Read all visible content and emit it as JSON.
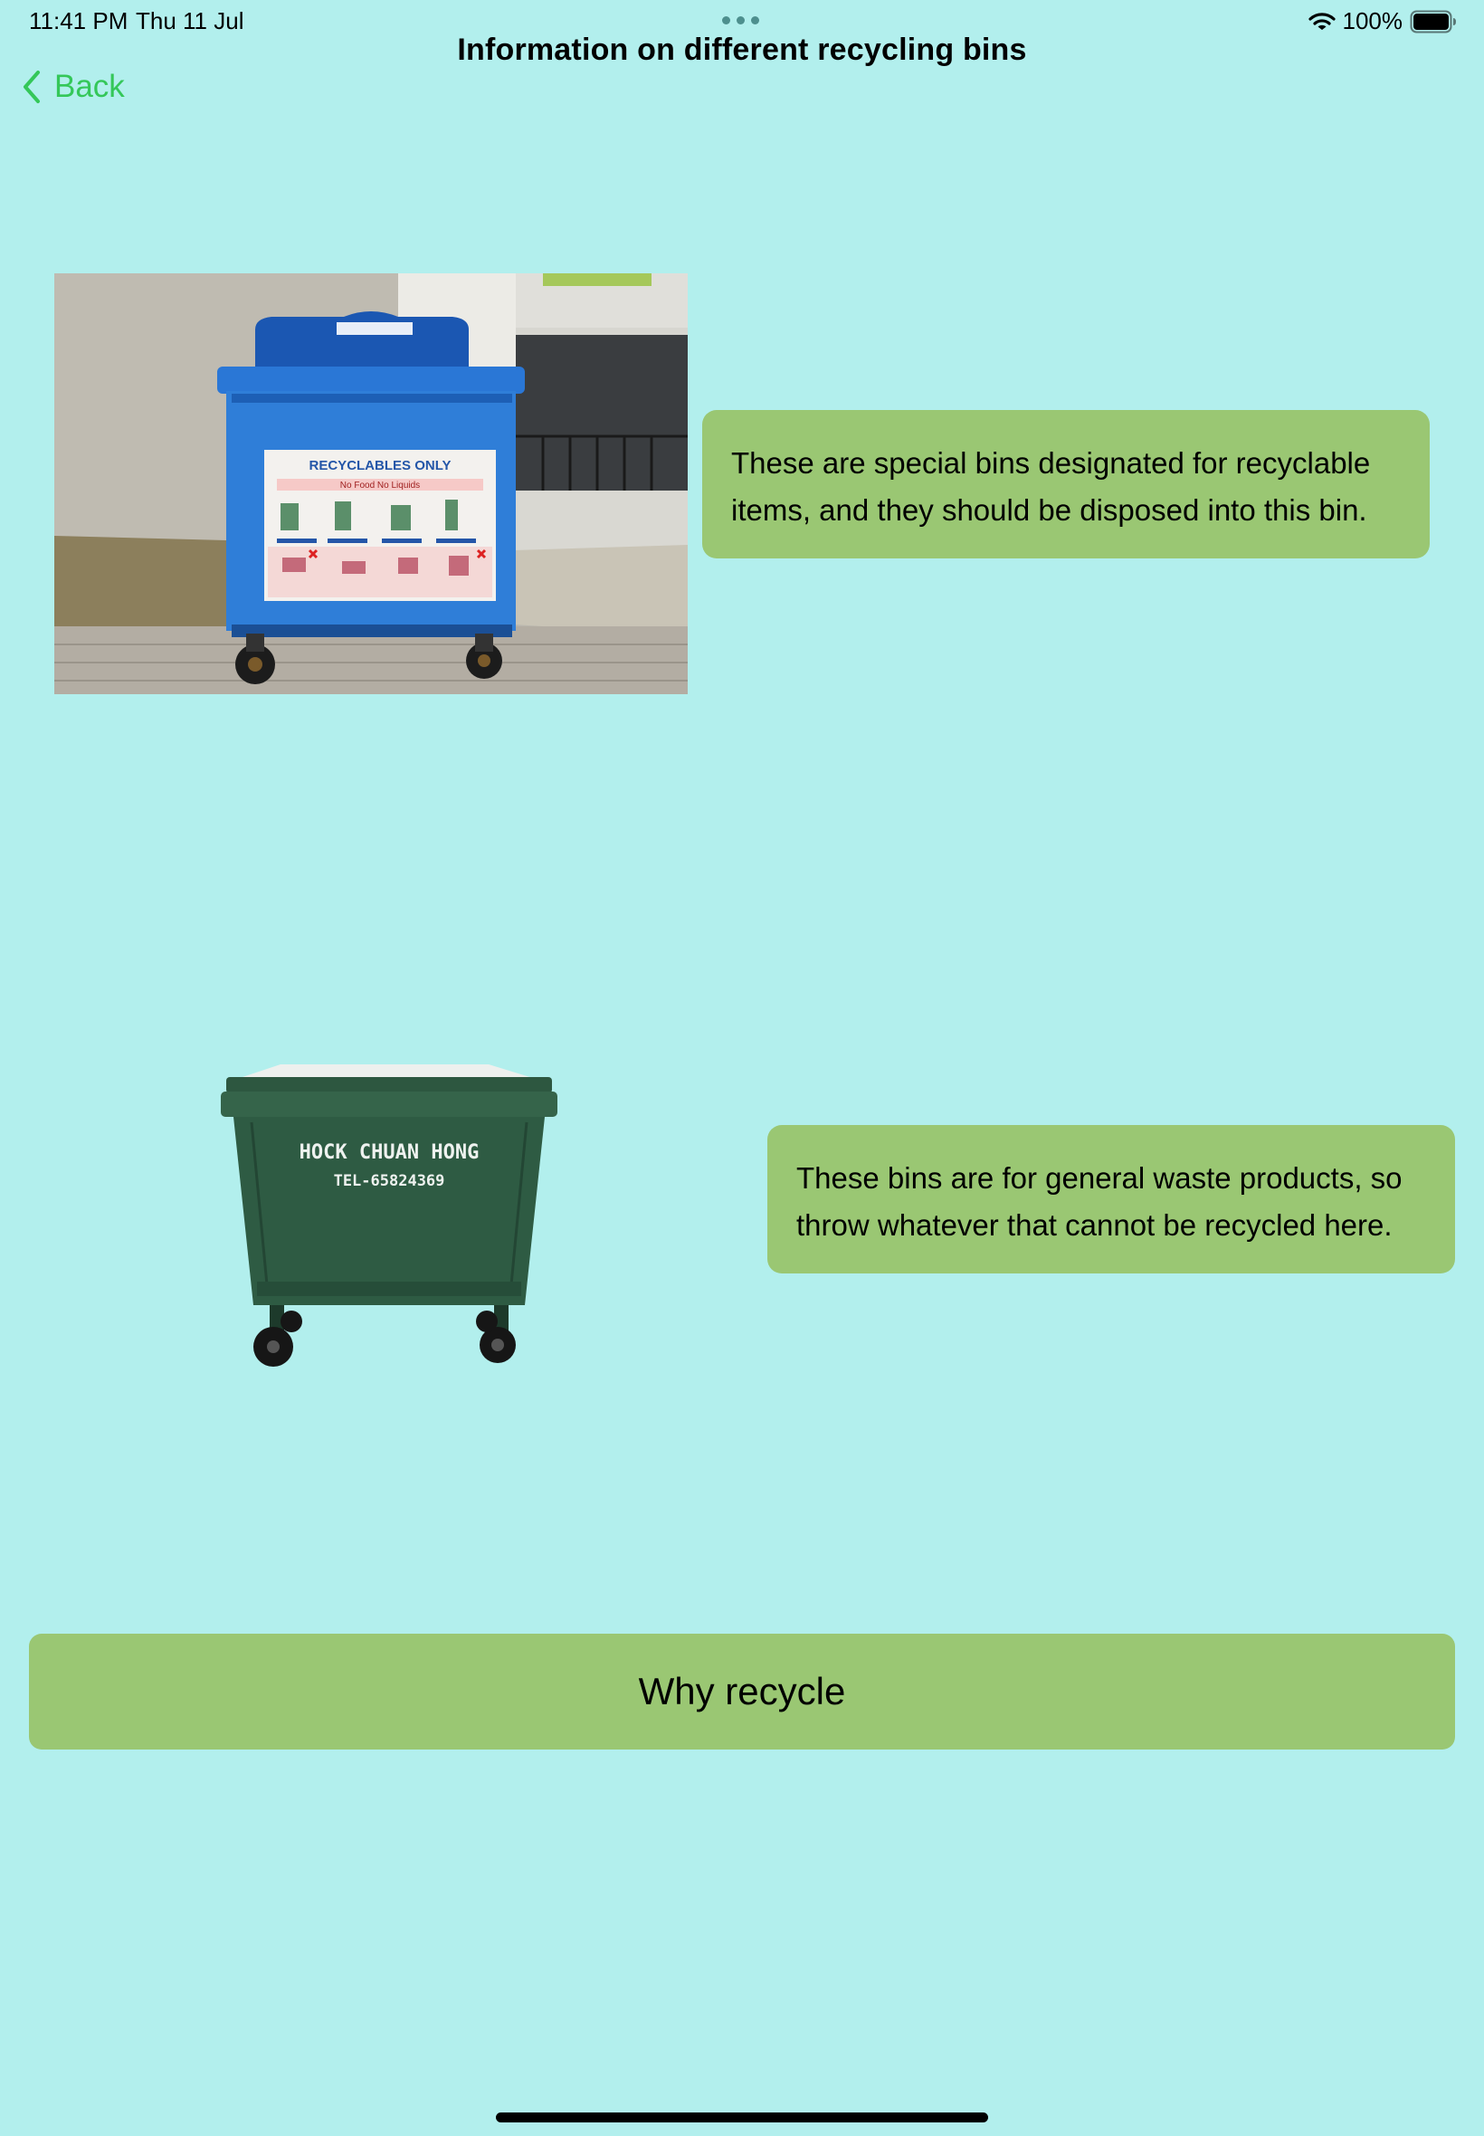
{
  "status_bar": {
    "time": "11:41 PM",
    "date": "Thu 11 Jul",
    "battery": "100%",
    "icons": [
      "multitask-dots-icon",
      "wifi-icon",
      "battery-icon"
    ]
  },
  "nav": {
    "title": "Information on different recycling bins",
    "back_label": "Back",
    "back_icon": "chevron-left-icon",
    "accent_color": "#34c759"
  },
  "bins": [
    {
      "image": "blue-recycling-bin-photo",
      "sign_text": "RECYCLABLES ONLY",
      "sign_subtext": "No Food No Liquids",
      "description": "These are special bins designated for recyclable items, and they should be disposed into this bin."
    },
    {
      "image": "green-general-waste-bin-photo",
      "bin_text": "HOCK CHUAN HONG",
      "bin_phone": "TEL-65824369",
      "description": "These bins are for general waste products, so throw whatever that cannot be recycled here."
    }
  ],
  "actions": {
    "why_recycle_label": "Why recycle"
  },
  "colors": {
    "background": "#b2efed",
    "bubble": "#9ac773",
    "button": "#9ac773"
  }
}
